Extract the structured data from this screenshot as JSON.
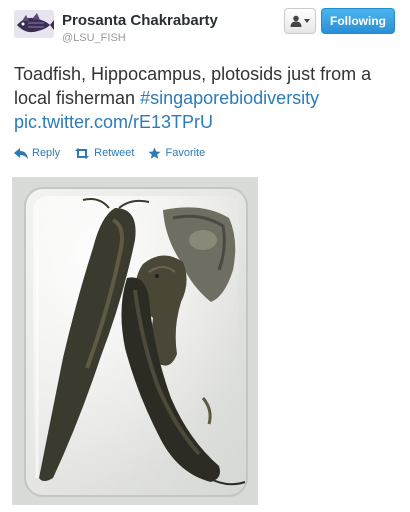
{
  "user": {
    "display_name": "Prosanta Chakrabarty",
    "handle": "@LSU_FISH"
  },
  "buttons": {
    "follow_label": "Following"
  },
  "tweet": {
    "text": "Toadfish, Hippocampus, plotosids just from a local fisherman",
    "hashtag": "#singaporebiodiversity",
    "pic_link": "pic.twitter.com/rE13TPrU"
  },
  "actions": [
    {
      "label": "Reply",
      "icon": "reply-icon"
    },
    {
      "label": "Retweet",
      "icon": "retweet-icon"
    },
    {
      "label": "Favorite",
      "icon": "star-icon"
    }
  ],
  "colors": {
    "link": "#2b7bb9",
    "follow_button": "#2a8fd6",
    "text": "#333333",
    "muted": "#999999"
  }
}
